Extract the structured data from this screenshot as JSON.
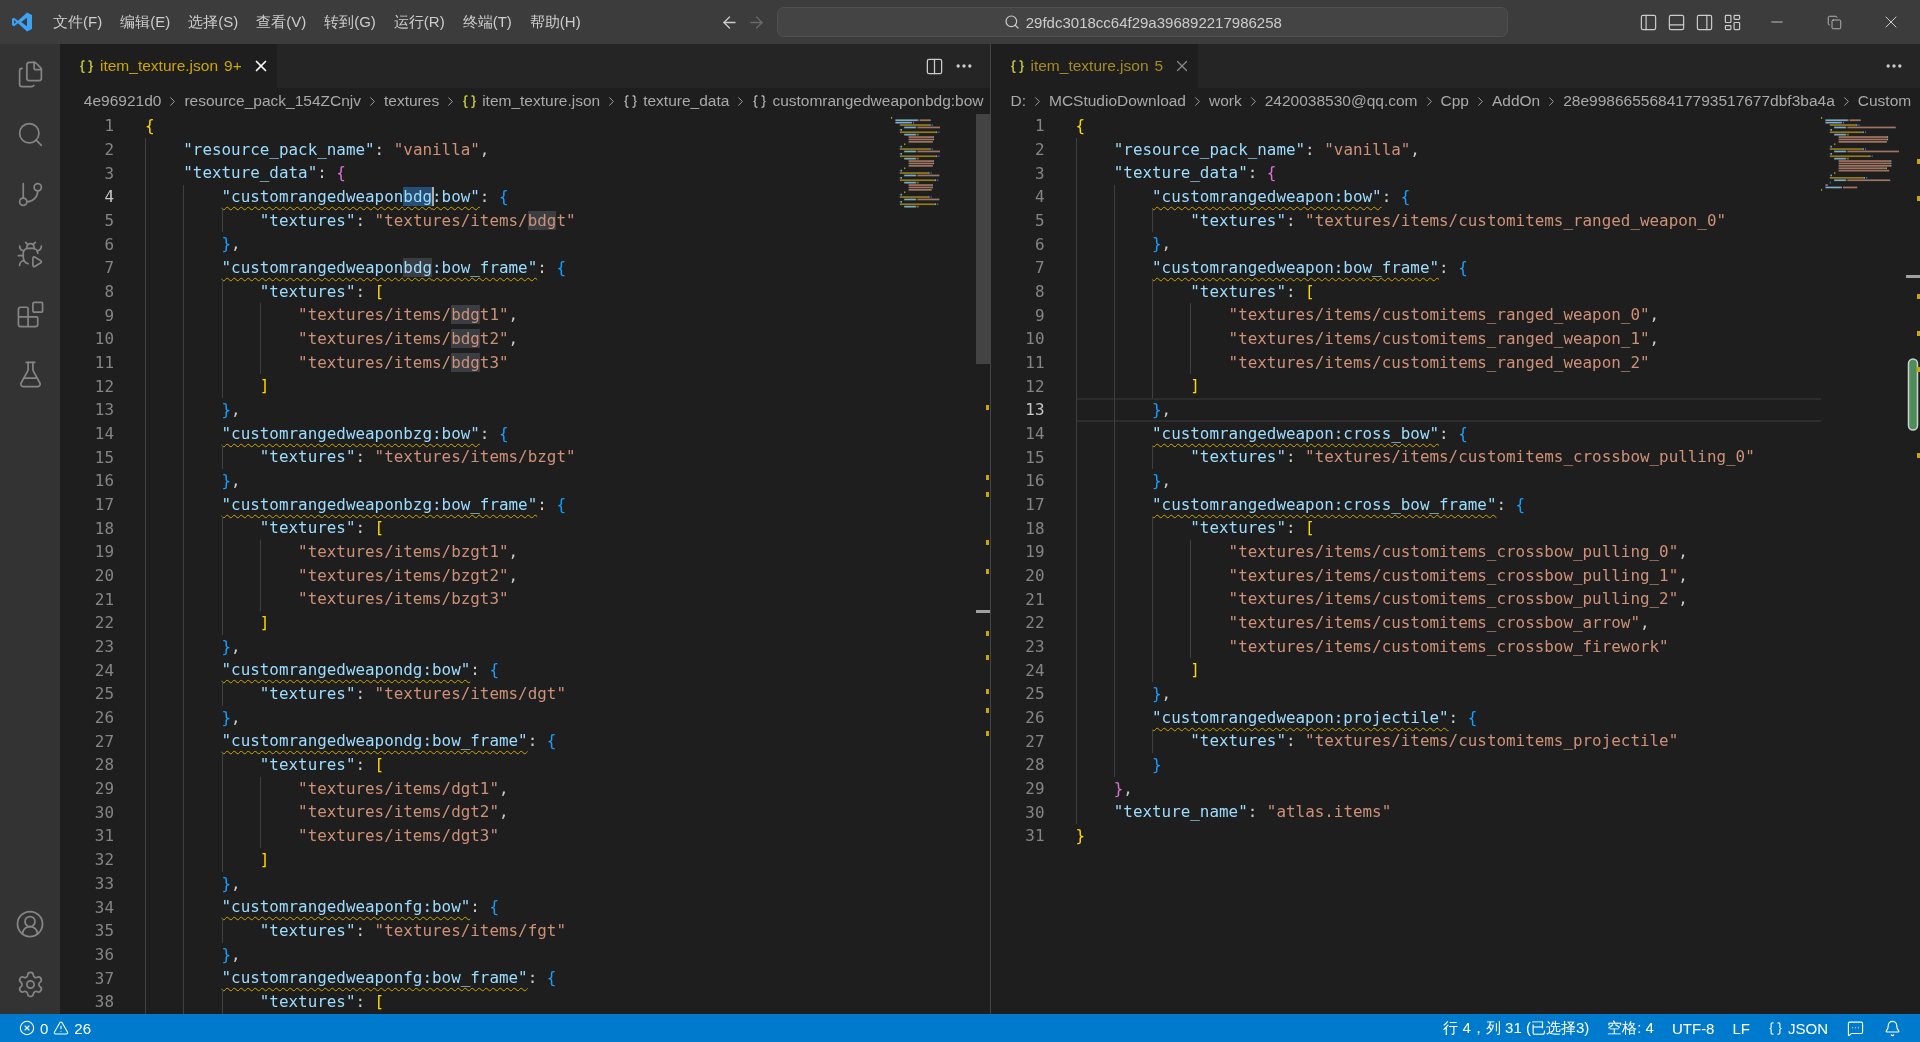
{
  "title_bar": {
    "menus": [
      "文件(F)",
      "编辑(E)",
      "选择(S)",
      "查看(V)",
      "转到(G)",
      "运行(R)",
      "终端(T)",
      "帮助(H)"
    ],
    "back_disabled": false,
    "forward_disabled": true,
    "command_center": "29fdc3018cc64f29a396892217986258"
  },
  "editors": [
    {
      "focused": true,
      "tab": {
        "label": "item_texture.json",
        "badge": "9+",
        "selected": true
      },
      "breadcrumbs": [
        {
          "label": "4e96921d0",
          "kind": "folder"
        },
        {
          "label": "resource_pack_154ZCnjv",
          "kind": "folder"
        },
        {
          "label": "textures",
          "kind": "folder"
        },
        {
          "label": "item_texture.json",
          "kind": "file"
        },
        {
          "label": "texture_data",
          "kind": "object"
        },
        {
          "label": "customrangedweaponbdg:bow",
          "kind": "object"
        }
      ],
      "lines": [
        {
          "number": "1",
          "current": false,
          "squiggle": false,
          "text": "{"
        },
        {
          "number": "2",
          "current": false,
          "squiggle": false,
          "text": "    \"resource_pack_name\": \"vanilla\","
        },
        {
          "number": "3",
          "current": false,
          "squiggle": false,
          "text": "    \"texture_data\": {"
        },
        {
          "number": "4",
          "current": true,
          "squiggle": true,
          "parts": [
            {
              "text": "        \"customrangedweapon",
              "kind": "plain"
            },
            {
              "text": "bdg",
              "kind": "selection"
            },
            {
              "text": ":bow\": {",
              "kind": "plain"
            }
          ]
        },
        {
          "number": "5",
          "current": false,
          "squiggle": false,
          "parts": [
            {
              "text": "            \"textures\": \"textures/items/",
              "kind": "plain"
            },
            {
              "text": "bdg",
              "kind": "match"
            },
            {
              "text": "t\"",
              "kind": "plain"
            }
          ]
        },
        {
          "number": "6",
          "current": false,
          "squiggle": false,
          "text": "        },"
        },
        {
          "number": "7",
          "current": false,
          "squiggle": true,
          "parts": [
            {
              "text": "        \"customrangedweapon",
              "kind": "plain"
            },
            {
              "text": "bdg",
              "kind": "match"
            },
            {
              "text": ":bow_frame\": {",
              "kind": "plain"
            }
          ]
        },
        {
          "number": "8",
          "current": false,
          "squiggle": false,
          "text": "            \"textures\": ["
        },
        {
          "number": "9",
          "current": false,
          "squiggle": false,
          "parts": [
            {
              "text": "                \"textures/items/",
              "kind": "plain"
            },
            {
              "text": "bdg",
              "kind": "match"
            },
            {
              "text": "t1\",",
              "kind": "plain"
            }
          ]
        },
        {
          "number": "10",
          "current": false,
          "squiggle": false,
          "parts": [
            {
              "text": "                \"textures/items/",
              "kind": "plain"
            },
            {
              "text": "bdg",
              "kind": "match"
            },
            {
              "text": "t2\",",
              "kind": "plain"
            }
          ]
        },
        {
          "number": "11",
          "current": false,
          "squiggle": false,
          "parts": [
            {
              "text": "                \"textures/items/",
              "kind": "plain"
            },
            {
              "text": "bdg",
              "kind": "match"
            },
            {
              "text": "t3\"",
              "kind": "plain"
            }
          ]
        },
        {
          "number": "12",
          "current": false,
          "squiggle": false,
          "text": "            ]"
        },
        {
          "number": "13",
          "current": false,
          "squiggle": false,
          "text": "        },"
        },
        {
          "number": "14",
          "current": false,
          "squiggle": true,
          "text": "        \"customrangedweaponbzg:bow\": {"
        },
        {
          "number": "15",
          "current": false,
          "squiggle": false,
          "text": "            \"textures\": \"textures/items/bzgt\""
        },
        {
          "number": "16",
          "current": false,
          "squiggle": false,
          "text": "        },"
        },
        {
          "number": "17",
          "current": false,
          "squiggle": true,
          "text": "        \"customrangedweaponbzg:bow_frame\": {"
        },
        {
          "number": "18",
          "current": false,
          "squiggle": false,
          "text": "            \"textures\": ["
        },
        {
          "number": "19",
          "current": false,
          "squiggle": false,
          "text": "                \"textures/items/bzgt1\","
        },
        {
          "number": "20",
          "current": false,
          "squiggle": false,
          "text": "                \"textures/items/bzgt2\","
        },
        {
          "number": "21",
          "current": false,
          "squiggle": false,
          "text": "                \"textures/items/bzgt3\""
        },
        {
          "number": "22",
          "current": false,
          "squiggle": false,
          "text": "            ]"
        },
        {
          "number": "23",
          "current": false,
          "squiggle": false,
          "text": "        },"
        },
        {
          "number": "24",
          "current": false,
          "squiggle": true,
          "text": "        \"customrangedweapondg:bow\": {"
        },
        {
          "number": "25",
          "current": false,
          "squiggle": false,
          "text": "            \"textures\": \"textures/items/dgt\""
        },
        {
          "number": "26",
          "current": false,
          "squiggle": false,
          "text": "        },"
        },
        {
          "number": "27",
          "current": false,
          "squiggle": true,
          "text": "        \"customrangedweapondg:bow_frame\": {"
        },
        {
          "number": "28",
          "current": false,
          "squiggle": false,
          "text": "            \"textures\": ["
        },
        {
          "number": "29",
          "current": false,
          "squiggle": false,
          "text": "                \"textures/items/dgt1\","
        },
        {
          "number": "30",
          "current": false,
          "squiggle": false,
          "text": "                \"textures/items/dgt2\","
        },
        {
          "number": "31",
          "current": false,
          "squiggle": false,
          "text": "                \"textures/items/dgt3\""
        },
        {
          "number": "32",
          "current": false,
          "squiggle": false,
          "text": "            ]"
        },
        {
          "number": "33",
          "current": false,
          "squiggle": false,
          "text": "        },"
        },
        {
          "number": "34",
          "current": false,
          "squiggle": true,
          "text": "        \"customrangedweaponfg:bow\": {"
        },
        {
          "number": "35",
          "current": false,
          "squiggle": false,
          "text": "            \"textures\": \"textures/items/fgt\""
        },
        {
          "number": "36",
          "current": false,
          "squiggle": false,
          "text": "        },"
        },
        {
          "number": "37",
          "current": false,
          "squiggle": true,
          "text": "        \"customrangedweaponfg:bow_frame\": {"
        },
        {
          "number": "38",
          "current": false,
          "squiggle": false,
          "text": "            \"textures\": ["
        }
      ]
    },
    {
      "focused": false,
      "tab": {
        "label": "item_texture.json",
        "badge": "5",
        "selected": true
      },
      "breadcrumbs": [
        {
          "label": "D:",
          "kind": "folder"
        },
        {
          "label": "MCStudioDownload",
          "kind": "folder"
        },
        {
          "label": "work",
          "kind": "folder"
        },
        {
          "label": "2420038530@qq.com",
          "kind": "folder"
        },
        {
          "label": "Cpp",
          "kind": "folder"
        },
        {
          "label": "AddOn",
          "kind": "folder"
        },
        {
          "label": "28e998665568417793517677dbf3ba4a",
          "kind": "folder"
        },
        {
          "label": "Custom",
          "kind": "folder"
        }
      ],
      "lines": [
        {
          "number": "1",
          "current": false,
          "squiggle": false,
          "text": "{"
        },
        {
          "number": "2",
          "current": false,
          "squiggle": false,
          "text": "    \"resource_pack_name\": \"vanilla\","
        },
        {
          "number": "3",
          "current": false,
          "squiggle": false,
          "text": "    \"texture_data\": {"
        },
        {
          "number": "4",
          "current": false,
          "squiggle": true,
          "text": "        \"customrangedweapon:bow\": {"
        },
        {
          "number": "5",
          "current": false,
          "squiggle": false,
          "text": "            \"textures\": \"textures/items/customitems_ranged_weapon_0\""
        },
        {
          "number": "6",
          "current": false,
          "squiggle": false,
          "text": "        },"
        },
        {
          "number": "7",
          "current": false,
          "squiggle": true,
          "text": "        \"customrangedweapon:bow_frame\": {"
        },
        {
          "number": "8",
          "current": false,
          "squiggle": false,
          "text": "            \"textures\": ["
        },
        {
          "number": "9",
          "current": false,
          "squiggle": false,
          "text": "                \"textures/items/customitems_ranged_weapon_0\","
        },
        {
          "number": "10",
          "current": false,
          "squiggle": false,
          "text": "                \"textures/items/customitems_ranged_weapon_1\","
        },
        {
          "number": "11",
          "current": false,
          "squiggle": false,
          "text": "                \"textures/items/customitems_ranged_weapon_2\""
        },
        {
          "number": "12",
          "current": false,
          "squiggle": false,
          "text": "            ]"
        },
        {
          "number": "13",
          "current": true,
          "squiggle": false,
          "text": "        },"
        },
        {
          "number": "14",
          "current": false,
          "squiggle": true,
          "text": "        \"customrangedweapon:cross_bow\": {"
        },
        {
          "number": "15",
          "current": false,
          "squiggle": false,
          "text": "            \"textures\": \"textures/items/customitems_crossbow_pulling_0\""
        },
        {
          "number": "16",
          "current": false,
          "squiggle": false,
          "text": "        },"
        },
        {
          "number": "17",
          "current": false,
          "squiggle": true,
          "text": "        \"customrangedweapon:cross_bow_frame\": {"
        },
        {
          "number": "18",
          "current": false,
          "squiggle": false,
          "text": "            \"textures\": ["
        },
        {
          "number": "19",
          "current": false,
          "squiggle": false,
          "text": "                \"textures/items/customitems_crossbow_pulling_0\","
        },
        {
          "number": "20",
          "current": false,
          "squiggle": false,
          "text": "                \"textures/items/customitems_crossbow_pulling_1\","
        },
        {
          "number": "21",
          "current": false,
          "squiggle": false,
          "text": "                \"textures/items/customitems_crossbow_pulling_2\","
        },
        {
          "number": "22",
          "current": false,
          "squiggle": false,
          "text": "                \"textures/items/customitems_crossbow_arrow\","
        },
        {
          "number": "23",
          "current": false,
          "squiggle": false,
          "text": "                \"textures/items/customitems_crossbow_firework\""
        },
        {
          "number": "24",
          "current": false,
          "squiggle": false,
          "text": "            ]"
        },
        {
          "number": "25",
          "current": false,
          "squiggle": false,
          "text": "        },"
        },
        {
          "number": "26",
          "current": false,
          "squiggle": true,
          "text": "        \"customrangedweapon:projectile\": {"
        },
        {
          "number": "27",
          "current": false,
          "squiggle": false,
          "text": "            \"textures\": \"textures/items/customitems_projectile\""
        },
        {
          "number": "28",
          "current": false,
          "squiggle": false,
          "text": "        }"
        },
        {
          "number": "29",
          "current": false,
          "squiggle": false,
          "text": "    },"
        },
        {
          "number": "30",
          "current": false,
          "squiggle": false,
          "text": "    \"texture_name\": \"atlas.items\""
        },
        {
          "number": "31",
          "current": false,
          "squiggle": false,
          "text": "}"
        }
      ]
    }
  ],
  "status_bar": {
    "problems": {
      "errors": "0",
      "warnings": "26"
    },
    "items": [
      {
        "text": "行 4，列 31 (已选择3)",
        "kind": "plain"
      },
      {
        "text": "空格: 4",
        "kind": "plain"
      },
      {
        "text": "UTF-8",
        "kind": "plain"
      },
      {
        "text": "LF",
        "kind": "plain"
      },
      {
        "text": "JSON",
        "kind": "language"
      }
    ]
  }
}
